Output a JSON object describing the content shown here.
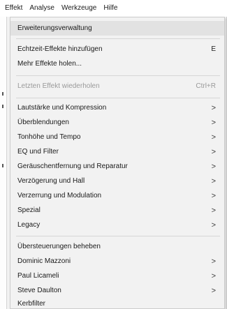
{
  "menubar": {
    "items": [
      {
        "label": "Effekt"
      },
      {
        "label": "Analyse"
      },
      {
        "label": "Werkzeuge"
      },
      {
        "label": "Hilfe"
      }
    ]
  },
  "menu": {
    "items": [
      {
        "label": "Erweiterungsverwaltung",
        "accel": "",
        "submenu": false,
        "disabled": false,
        "highlighted": true
      },
      {
        "label": "Echtzeit-Effekte hinzufügen",
        "accel": "E",
        "submenu": false,
        "disabled": false
      },
      {
        "label": "Mehr Effekte holen...",
        "accel": "",
        "submenu": false,
        "disabled": false
      },
      {
        "label": "Letzten Effekt wiederholen",
        "accel": "Ctrl+R",
        "submenu": false,
        "disabled": true
      },
      {
        "label": "Lautstärke und Kompression",
        "accel": "",
        "submenu": true,
        "disabled": false
      },
      {
        "label": "Überblendungen",
        "accel": "",
        "submenu": true,
        "disabled": false
      },
      {
        "label": "Tonhöhe und Tempo",
        "accel": "",
        "submenu": true,
        "disabled": false
      },
      {
        "label": "EQ und Filter",
        "accel": "",
        "submenu": true,
        "disabled": false
      },
      {
        "label": "Geräuschentfernung und Reparatur",
        "accel": "",
        "submenu": true,
        "disabled": false
      },
      {
        "label": "Verzögerung und Hall",
        "accel": "",
        "submenu": true,
        "disabled": false
      },
      {
        "label": "Verzerrung und Modulation",
        "accel": "",
        "submenu": true,
        "disabled": false
      },
      {
        "label": "Spezial",
        "accel": "",
        "submenu": true,
        "disabled": false
      },
      {
        "label": "Legacy",
        "accel": "",
        "submenu": true,
        "disabled": false
      },
      {
        "label": "Übersteuerungen beheben",
        "accel": "",
        "submenu": false,
        "disabled": false
      },
      {
        "label": "Dominic Mazzoni",
        "accel": "",
        "submenu": true,
        "disabled": false
      },
      {
        "label": "Paul Licameli",
        "accel": "",
        "submenu": true,
        "disabled": false
      },
      {
        "label": "Steve Daulton",
        "accel": "",
        "submenu": true,
        "disabled": false
      },
      {
        "label": "Kerbfilter",
        "accel": "",
        "submenu": false,
        "disabled": false
      }
    ],
    "submenu_glyph": ">"
  }
}
